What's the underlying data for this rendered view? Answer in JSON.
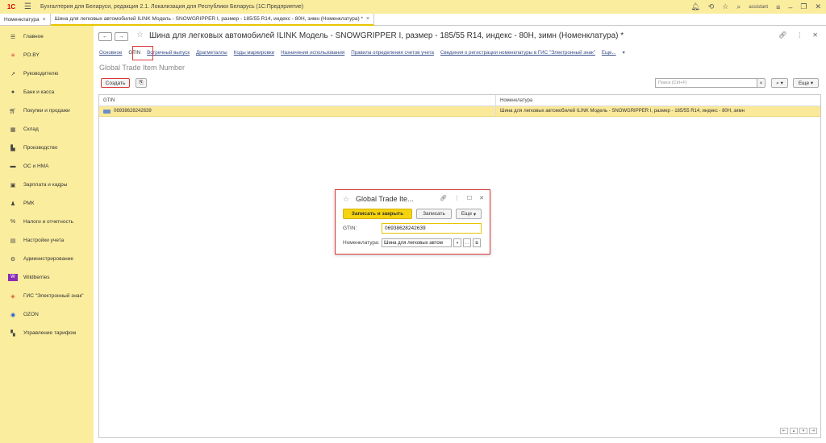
{
  "app": {
    "title": "Бухгалтерия для Беларуси, редакция 2.1. Локализация для Республики Беларусь   (1С:Предприятие)",
    "user": "assistant"
  },
  "tabs": [
    {
      "label": "Номенклатура"
    },
    {
      "label": "Шина для легковых автомобилей ILINK  Модель - SNOWGRIPPER I, размер - 185/55 R14, индекс - 80H, зимн (Номенклатура) *"
    }
  ],
  "sidebar": {
    "items": [
      {
        "label": "Главное",
        "icon": "menu-icon"
      },
      {
        "label": "PO.BY",
        "icon": "asterisk-icon"
      },
      {
        "label": "Руководителю",
        "icon": "trend-icon"
      },
      {
        "label": "Банк и касса",
        "icon": "coin-icon"
      },
      {
        "label": "Покупки и продажи",
        "icon": "cart-icon"
      },
      {
        "label": "Склад",
        "icon": "warehouse-icon"
      },
      {
        "label": "Производство",
        "icon": "factory-icon"
      },
      {
        "label": "ОС и НМА",
        "icon": "truck-icon"
      },
      {
        "label": "Зарплата и кадры",
        "icon": "wallet-icon"
      },
      {
        "label": "РМК",
        "icon": "cashier-icon"
      },
      {
        "label": "Налоги и отчетность",
        "icon": "percent-icon"
      },
      {
        "label": "Настройки учета",
        "icon": "docs-icon"
      },
      {
        "label": "Администрирование",
        "icon": "gear-icon"
      },
      {
        "label": "Wildberries",
        "icon": "wildberries-icon"
      },
      {
        "label": "ГИС \"Электронный знак\"",
        "icon": "diamond-icon"
      },
      {
        "label": "OZON",
        "icon": "ozon-icon"
      },
      {
        "label": "Управление тарифом",
        "icon": "grid-icon"
      }
    ]
  },
  "header": {
    "title": "Шина для легковых автомобилей ILINK  Модель - SNOWGRIPPER I, размер - 185/55 R14, индекс - 80H, зимн (Номенклатура) *"
  },
  "links": [
    "Основное",
    "GTIN",
    "Встречный выпуск",
    "Драгметаллы",
    "Коды маркировки",
    "Назначения использования",
    "Правила определения счетов учета",
    "Сведения о регистрации номенклатуры в ГИС \"Электронный знак\"",
    "Еще..."
  ],
  "section": {
    "title": "Global Trade Item Number"
  },
  "toolbar": {
    "create_label": "Создать",
    "search_placeholder": "Поиск (Ctrl+F)",
    "more_label": "Еще"
  },
  "table": {
    "columns": [
      "GTIN",
      "Номенклатура"
    ],
    "rows": [
      {
        "gtin": "06938628242639",
        "item": "Шина для легковых автомобилей ILINK  Модель - SNOWGRIPPER I, размер - 185/55 R14, индекс - 80H, зимн"
      }
    ]
  },
  "dialog": {
    "title": "Global Trade Ite...",
    "save_close": "Записать и закрыть",
    "save": "Записать",
    "more": "Еще",
    "gtin_label": "GTIN:",
    "gtin_value": "06938628242639",
    "item_label": "Номенклатура:",
    "item_value": "Шина для легковых автом"
  },
  "colors": {
    "accent": "#f5d40f",
    "sidebar": "#fbed9e",
    "highlight": "#d9383a"
  }
}
